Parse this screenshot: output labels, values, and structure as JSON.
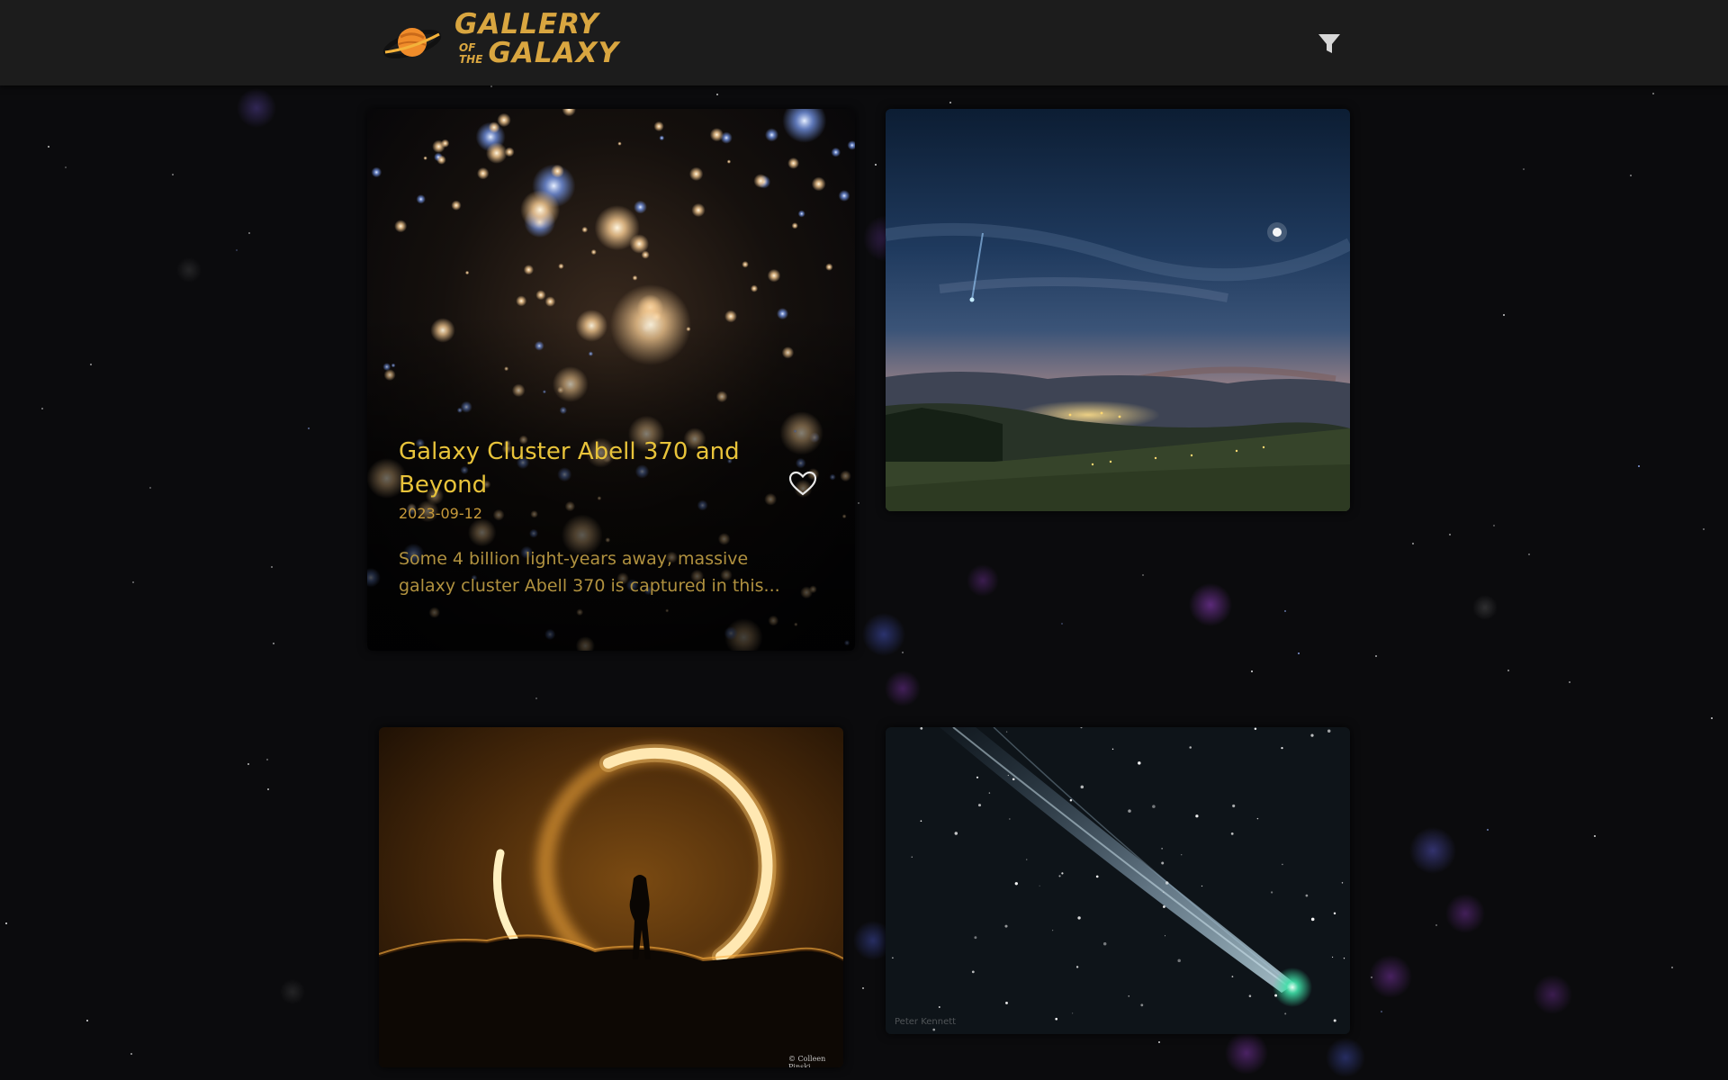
{
  "app": {
    "logo": {
      "line1": "GALLERY",
      "line2_small_a": "OF",
      "line2_small_b": "THE",
      "line2": "GALAXY",
      "icon": "planet-icon",
      "colors": {
        "text": "#d9a640",
        "planet": "#f08c2a"
      }
    },
    "filter_icon": "filter-icon"
  },
  "gallery": {
    "cards": [
      {
        "image": "galaxy-cluster-image",
        "title": "Galaxy Cluster Abell 370 and Beyond",
        "date": "2023-09-12",
        "description": "Some 4 billion light-years away, massive galaxy cluster Abell 370 is captured in this...",
        "favorite_icon": "heart-outline-icon",
        "favorited": false
      },
      {
        "image": "comet-over-valley-image"
      },
      {
        "image": "eclipse-silhouette-image",
        "credit": "© Colleen Pinski"
      },
      {
        "image": "green-comet-tail-image",
        "credit": "Peter Kennett"
      }
    ]
  },
  "colors": {
    "background": "#0b0b0d",
    "header": "#1c1c1c",
    "title": "#e8c33a",
    "date": "#c79a3a",
    "description": "#b0913f"
  }
}
